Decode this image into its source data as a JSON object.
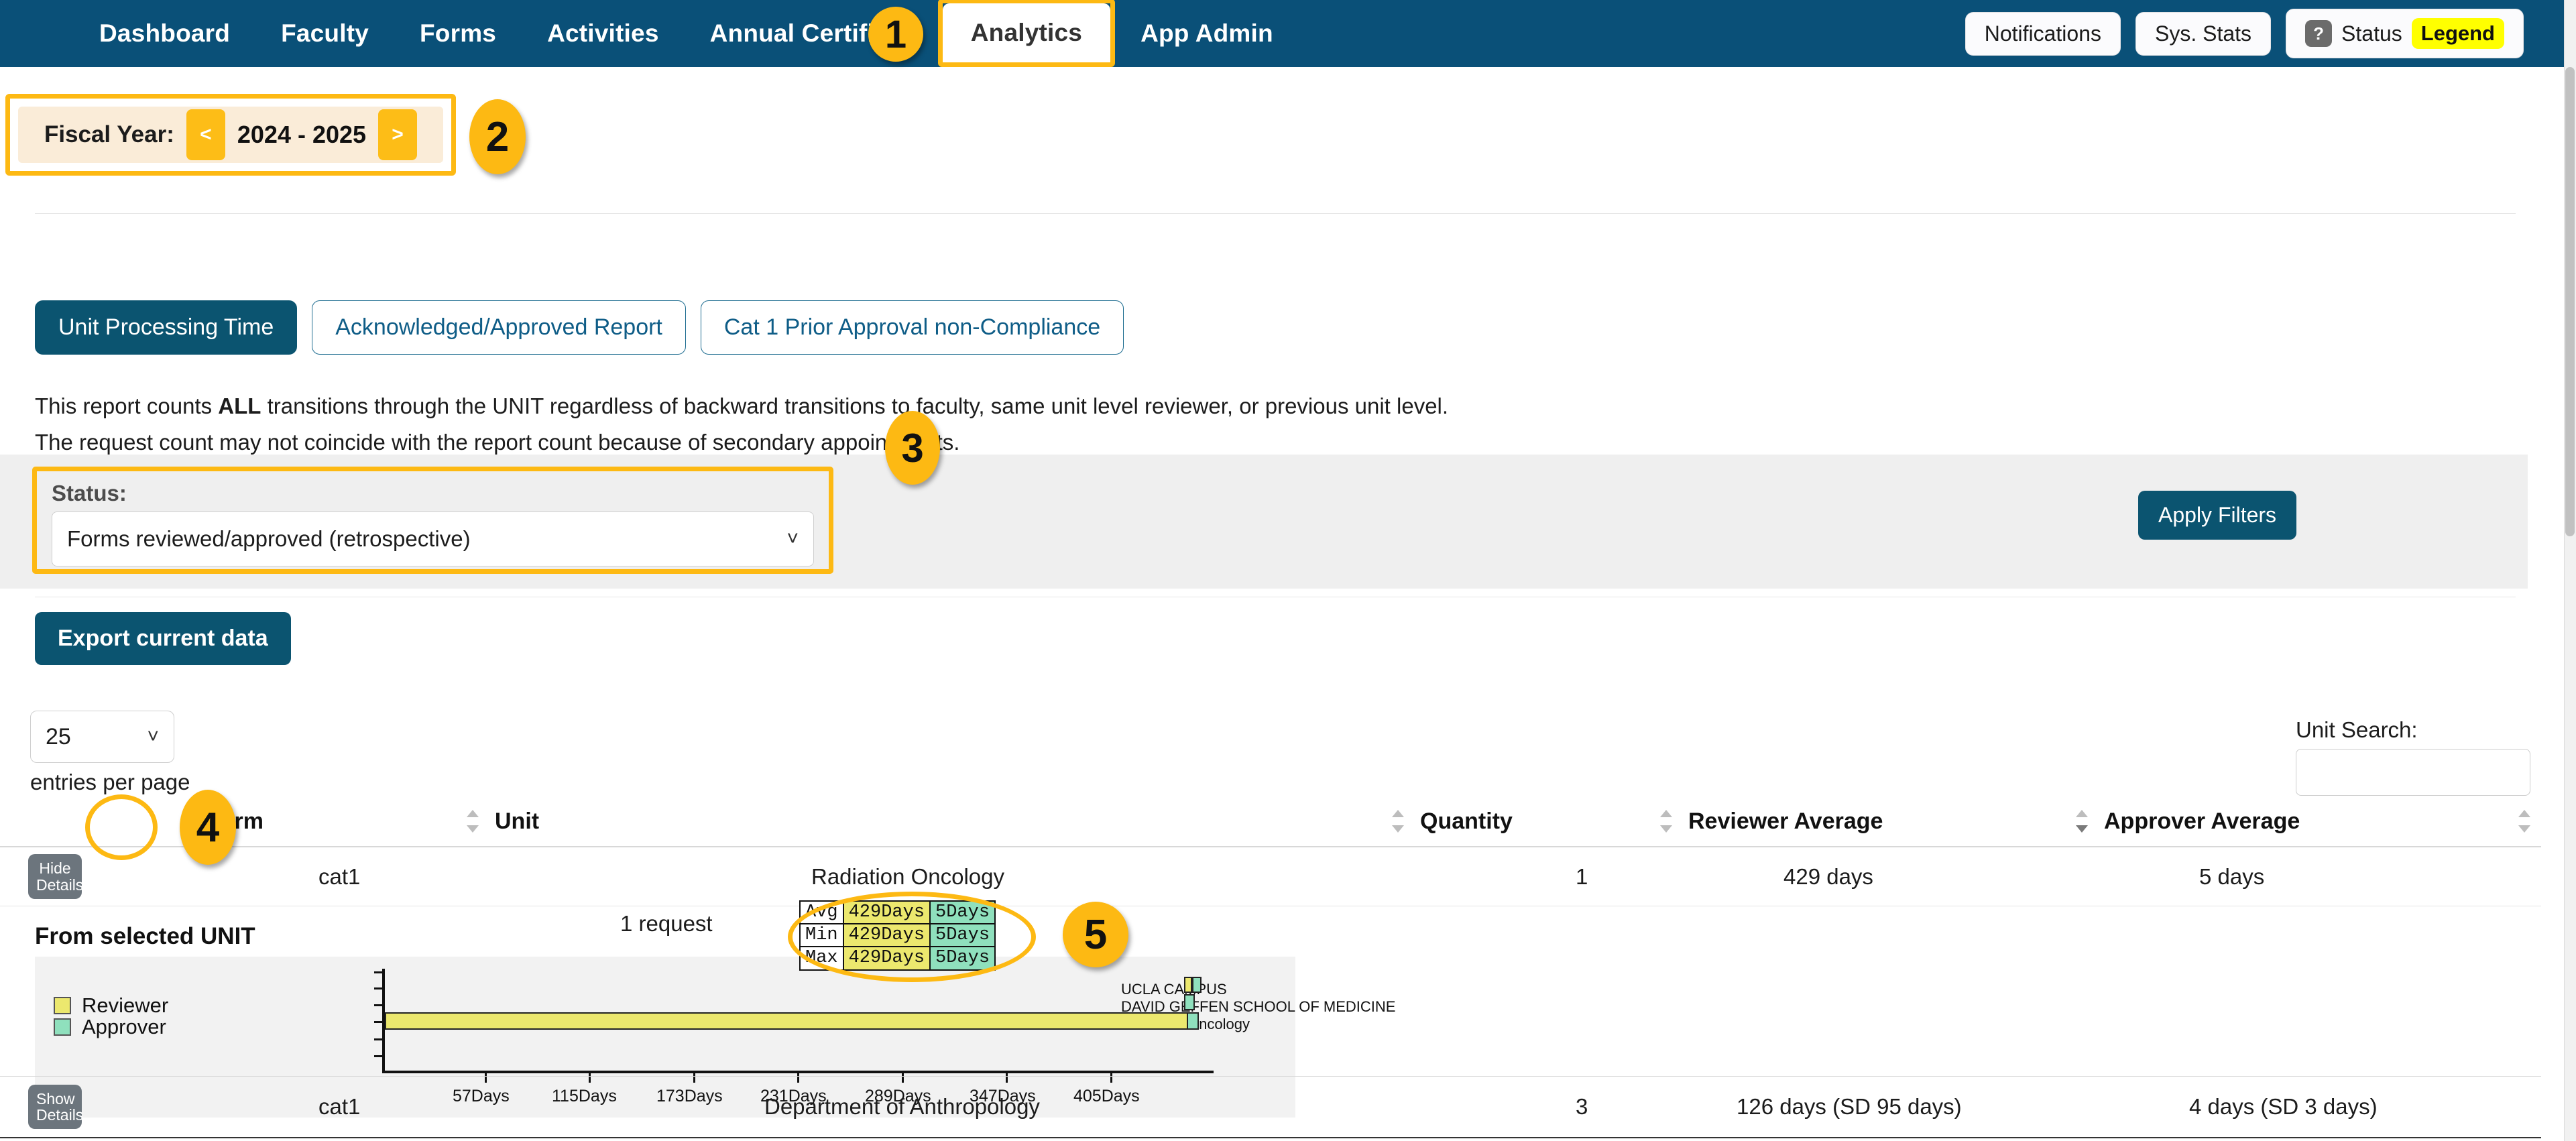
{
  "nav": {
    "items": [
      {
        "label": "Dashboard",
        "active": false
      },
      {
        "label": "Faculty",
        "active": false
      },
      {
        "label": "Forms",
        "active": false
      },
      {
        "label": "Activities",
        "active": false
      },
      {
        "label": "Annual Certific",
        "active": false
      },
      {
        "label": "Analytics",
        "active": true
      },
      {
        "label": "App Admin",
        "active": false
      }
    ],
    "right": {
      "notifications": "Notifications",
      "sys_stats": "Sys. Stats",
      "status": "Status",
      "legend": "Legend",
      "help_icon": "?"
    }
  },
  "fiscal_year": {
    "label": "Fiscal Year:",
    "prev": "<",
    "next": ">",
    "value": "2024 - 2025"
  },
  "report_tabs": [
    {
      "label": "Unit Processing Time",
      "active": true
    },
    {
      "label": "Acknowledged/Approved Report",
      "active": false
    },
    {
      "label": "Cat 1 Prior Approval non-Compliance",
      "active": false
    }
  ],
  "description": {
    "line1_a": "This report counts ",
    "line1_b": "ALL",
    "line1_c": " transitions through the UNIT regardless of backward transitions to faculty, same unit level reviewer, or previous unit level.",
    "line2": "The request count may not coincide with the report count because of secondary appointments."
  },
  "filters": {
    "status_label": "Status:",
    "status_value": "Forms reviewed/approved (retrospective)",
    "apply_label": "Apply Filters"
  },
  "export": {
    "label": "Export current data"
  },
  "pagination": {
    "per_page_value": "25",
    "per_page_text": "entries per page"
  },
  "unit_search": {
    "label": "Unit Search:",
    "value": "",
    "placeholder": ""
  },
  "table": {
    "columns": [
      "",
      "Form",
      "Unit",
      "Quantity",
      "Reviewer Average",
      "Approver Average"
    ],
    "rows": [
      {
        "action": "Hide\nDetails",
        "action_line1": "Hide",
        "action_line2": "Details",
        "form": "cat1",
        "unit": "Radiation Oncology",
        "quantity": "1",
        "reviewer_average": "429 days",
        "approver_average": "5 days",
        "expanded": true
      },
      {
        "action_line1": "Show",
        "action_line2": "Details",
        "form": "cat1",
        "unit": "Department of Anthropology",
        "quantity": "3",
        "reviewer_average": "126 days (SD 95 days)",
        "approver_average": "4 days (SD 3 days)",
        "expanded": false
      }
    ]
  },
  "detail": {
    "title": "From selected UNIT",
    "request_count": "1 request",
    "legend": [
      {
        "label": "Reviewer",
        "color": "#ece86e"
      },
      {
        "label": "Approver",
        "color": "#8fe0bd"
      }
    ],
    "stats": {
      "rows": [
        {
          "label": "Avg",
          "reviewer": "429Days",
          "approver": "5Days"
        },
        {
          "label": "Min",
          "reviewer": "429Days",
          "approver": "5Days"
        },
        {
          "label": "Max",
          "reviewer": "429Days",
          "approver": "5Days"
        }
      ]
    }
  },
  "chart_data": {
    "type": "bar",
    "orientation": "horizontal",
    "title": "From selected UNIT",
    "xlabel": "",
    "ylabel": "",
    "categories": [
      "UCLA CAMPUS",
      "DAVID GEFFEN SCHOOL OF MEDICINE",
      "Radiation Oncology"
    ],
    "series": [
      {
        "name": "Reviewer",
        "color": "#ece86e",
        "values": [
          0,
          0,
          429
        ]
      },
      {
        "name": "Approver",
        "color": "#8fe0bd",
        "values": [
          5,
          5,
          5
        ]
      }
    ],
    "xticks": [
      "57Days",
      "115Days",
      "173Days",
      "231Days",
      "289Days",
      "347Days",
      "405Days"
    ],
    "xtick_values": [
      57,
      115,
      173,
      231,
      289,
      347,
      405
    ],
    "xlim": [
      0,
      450
    ],
    "grid": false,
    "legend_position": "top-left"
  },
  "callouts": [
    {
      "n": "1"
    },
    {
      "n": "2"
    },
    {
      "n": "3"
    },
    {
      "n": "4"
    },
    {
      "n": "5"
    }
  ],
  "colors": {
    "nav_bg": "#0a5078",
    "accent_yellow": "#FDB913",
    "primary_teal": "#0b5470",
    "reviewer": "#ece86e",
    "approver": "#8fe0bd"
  }
}
